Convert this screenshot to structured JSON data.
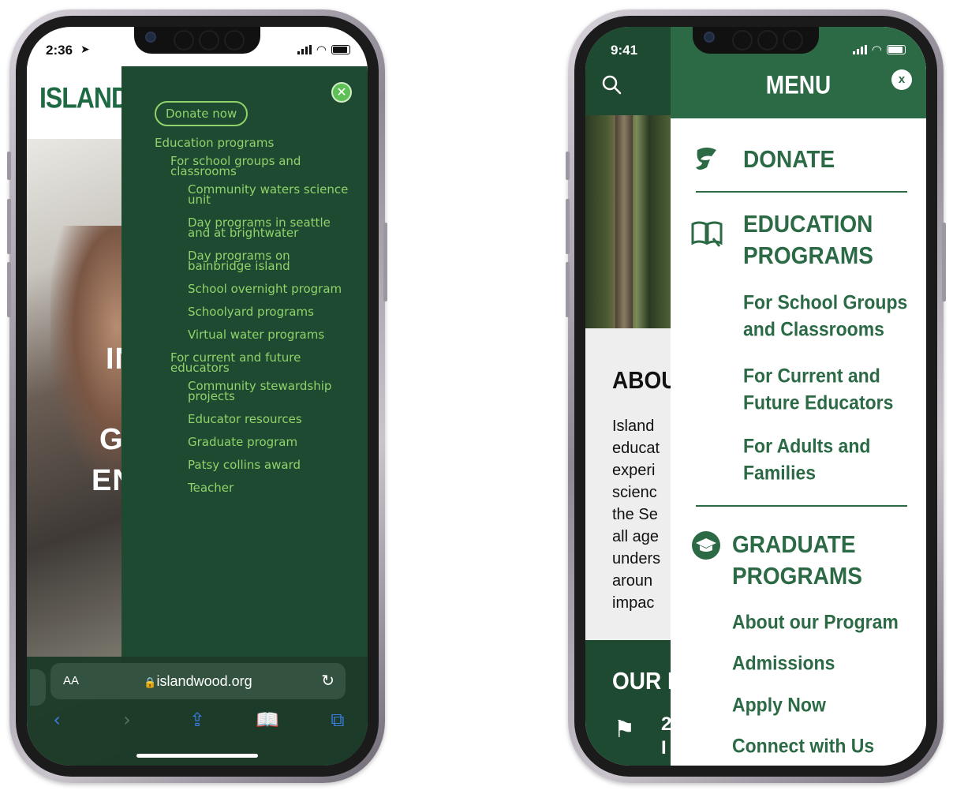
{
  "left_phone": {
    "status": {
      "time": "2:36"
    },
    "logo": "ISLANDW",
    "hero_lines": [
      "IN",
      "GI",
      "EN"
    ],
    "menu": {
      "donate": "Donate now",
      "items": [
        {
          "level": 1,
          "label": "Education programs"
        },
        {
          "level": 2,
          "label": "For school groups and classrooms"
        },
        {
          "level": 3,
          "label": "Community waters science unit"
        },
        {
          "level": 3,
          "label": "Day programs in seattle and at brightwater"
        },
        {
          "level": 3,
          "label": "Day programs on bainbridge island"
        },
        {
          "level": 3,
          "label": "School overnight program"
        },
        {
          "level": 3,
          "label": "Schoolyard programs"
        },
        {
          "level": 3,
          "label": "Virtual water programs"
        },
        {
          "level": 2,
          "label": "For current and future educators"
        },
        {
          "level": 3,
          "label": "Community stewardship projects"
        },
        {
          "level": 3,
          "label": "Educator resources"
        },
        {
          "level": 3,
          "label": "Graduate program"
        },
        {
          "level": 3,
          "label": "Patsy collins award"
        },
        {
          "level": 3,
          "label": "Teacher"
        }
      ]
    },
    "safari": {
      "text_size_label": "AA",
      "url": "islandwood.org"
    },
    "colors": {
      "menu_bg": "#1f4a32",
      "menu_text": "#8fd36a",
      "logo": "#1e6b43"
    }
  },
  "right_phone": {
    "status": {
      "time": "9:41"
    },
    "menu_title": "MENU",
    "close_label": "x",
    "donate": "DONATE",
    "education": {
      "title_line1": "EDUCATION",
      "title_line2": "PROGRAMS",
      "sub1_line1": "For School Groups",
      "sub1_line2": "and Classrooms",
      "sub2_line1": "For Current and",
      "sub2_line2": "Future Educators",
      "sub3_line1": "For Adults and",
      "sub3_line2": "Families"
    },
    "graduate": {
      "title_line1": "GRADUATE",
      "title_line2": "PROGRAMS",
      "links": [
        "About our Program",
        "Admissions",
        "Apply Now",
        "Connect with Us"
      ]
    },
    "background_page": {
      "about_title": "ABOU",
      "about_lines": "Island\neducat\nexperi\nscienc\nthe Se\nall age\nunders\naroun\nimpac",
      "section_title": "OUR I",
      "stat_lines": "2\nI"
    },
    "colors": {
      "header_bg": "#2b6a45",
      "menu_text": "#2b6a45"
    }
  }
}
